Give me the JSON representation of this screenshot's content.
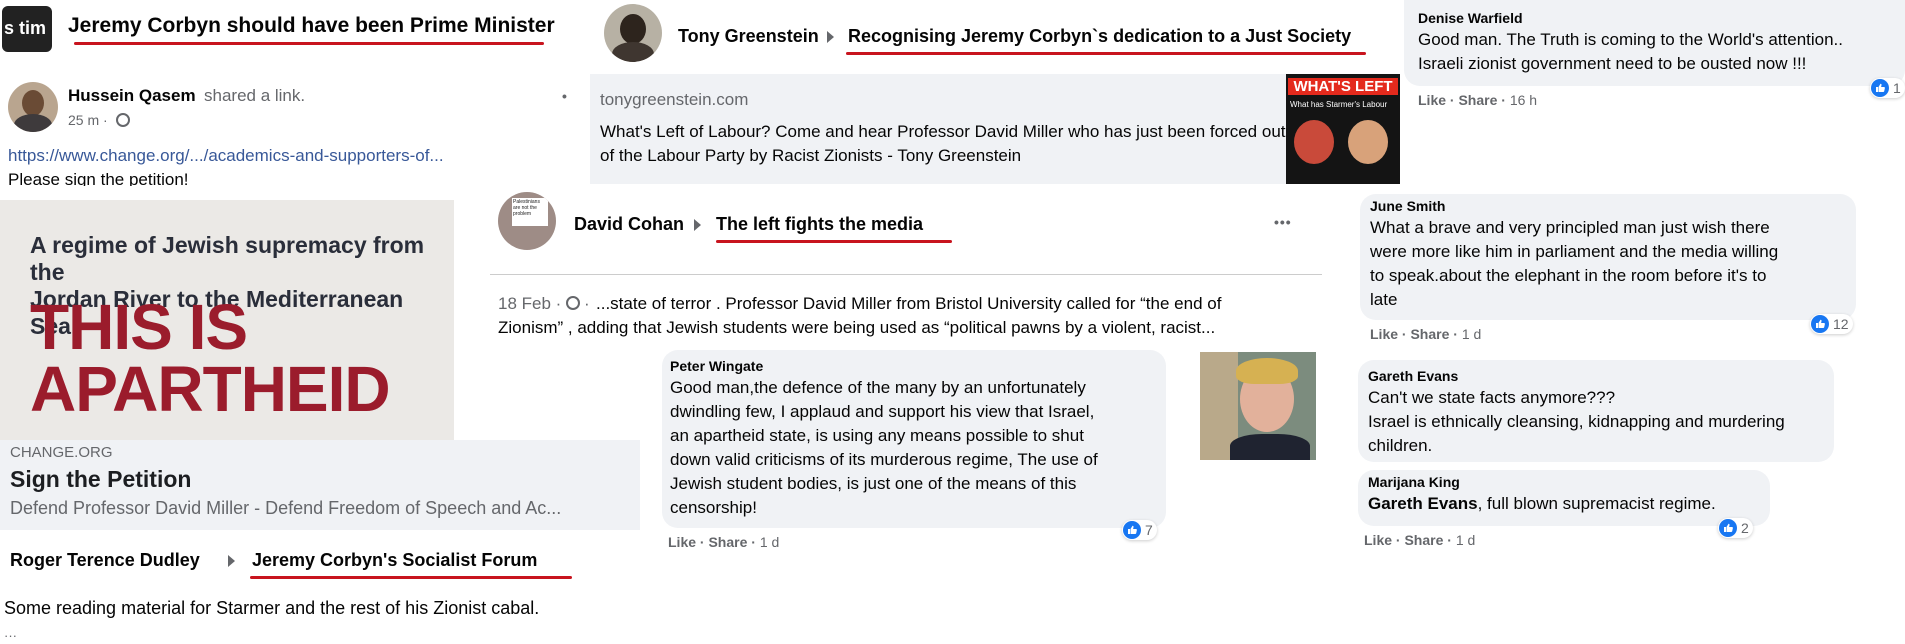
{
  "colors": {
    "underline": "#c8141e",
    "link": "#385898",
    "like": "#1877f2",
    "bubble": "#f0f2f5",
    "muted": "#65676b",
    "poster_red": "#9b1c2c"
  },
  "post_corbyn_pm": {
    "avatar_text": "s tim",
    "title": "Jeremy Corbyn should have been Prime Minister"
  },
  "post_greenstein": {
    "name": "Tony Greenstein",
    "group": "Recognising Jeremy Corbyn`s dedication to a Just Society",
    "link_domain": "tonygreenstein.com",
    "link_title": "What's Left of Labour? Come and hear Professor David Miller who has just been forced out of the Labour Party by Racist Zionists - Tony Greenstein",
    "thumb_title": "WHAT'S LEFT",
    "thumb_sub": "What has Starmer's Labour"
  },
  "post_qasem": {
    "name": "Hussein Qasem",
    "action": "shared a link.",
    "time": "25 m ·",
    "url": "https://www.change.org/.../academics-and-supporters-of...",
    "text": "Please sign the petition!",
    "poster_lines_top": [
      "A regime of Jewish supremacy from the",
      "Jordan River to the Mediterranean Sea:"
    ],
    "poster_big": [
      "THIS IS",
      "APARTHEID"
    ],
    "card_domain": "CHANGE.ORG",
    "card_title": "Sign the Petition",
    "card_desc": "Defend Professor David Miller - Defend Freedom of Speech and Ac..."
  },
  "post_dudley": {
    "name": "Roger Terence Dudley",
    "group": "Jeremy Corbyn's Socialist Forum",
    "text": "Some reading material for Starmer and the rest of his Zionist cabal."
  },
  "post_cohan": {
    "name": "David Cohan",
    "group": "The left fights the media",
    "more": "•••",
    "sign_text": "Palestinians are not the problem",
    "meta": "18 Feb · ",
    "excerpt_1": "...state of terror . Professor David Miller from Bristol University called for “the end of",
    "excerpt_2": "Zionism” , adding that Jewish students were being used as “political pawns by a violent, racist..."
  },
  "comment_wingate": {
    "name": "Peter Wingate",
    "lines": [
      "Good man,the defence of the many by an unfortunately",
      "dwindling few, I applaud and support his view that Israel,",
      "an apartheid state, is using any means possible to shut",
      "down valid criticisms of its murderous regime, The use of",
      "Jewish student bodies, is just one of the means of this",
      "censorship!"
    ],
    "like": "Like",
    "share": "Share",
    "time": "1 d",
    "reactions": "7"
  },
  "comment_warfield": {
    "name": "Denise Warfield",
    "lines": [
      "Good man. The Truth is coming to the World's attention..",
      "Israeli zionist government need to be ousted now !!!"
    ],
    "like": "Like",
    "share": "Share",
    "time": "16 h",
    "reactions": "1"
  },
  "comment_smith": {
    "name": "June Smith",
    "lines": [
      "What a brave and very principled man just wish there",
      "were more like him in parliament and the media willing",
      "to speak.about the elephant in the room before it's to",
      "late"
    ],
    "like": "Like",
    "share": "Share",
    "time": "1 d",
    "reactions": "12"
  },
  "comment_evans": {
    "name": "Gareth Evans",
    "lines": [
      "Can't we state facts anymore???",
      "Israel is ethnically cleansing, kidnapping and murdering",
      "children."
    ]
  },
  "comment_king": {
    "name": "Marijana King",
    "mention": "Gareth Evans",
    "text": ", full blown supremacist regime.",
    "like": "Like",
    "share": "Share",
    "time": "1 d",
    "reactions": "2"
  }
}
